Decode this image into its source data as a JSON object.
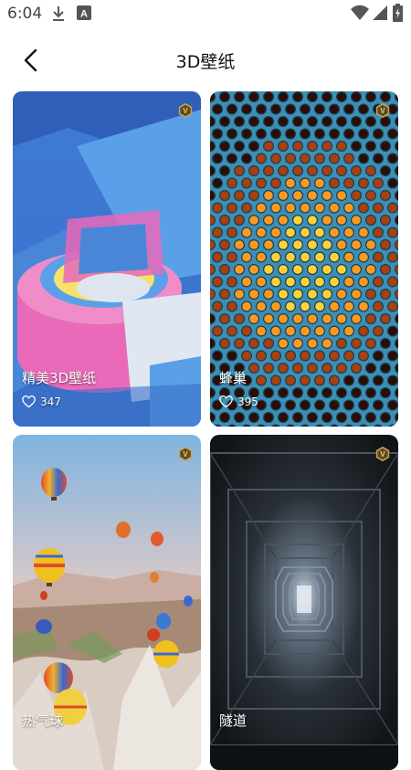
{
  "status_bar": {
    "time": "6:04",
    "icons": [
      "download-icon",
      "font-icon",
      "wifi-icon",
      "signal-icon",
      "battery-icon"
    ]
  },
  "header": {
    "title": "3D壁纸",
    "back_icon": "chevron-left-icon"
  },
  "wallpapers": [
    {
      "title": "精美3D壁纸",
      "likes": "347",
      "badge": "V"
    },
    {
      "title": "蜂巢",
      "likes": "395",
      "badge": "V"
    },
    {
      "title": "热气球",
      "likes": "",
      "badge": "V"
    },
    {
      "title": "隧道",
      "likes": "",
      "badge": "V"
    }
  ],
  "colors": {
    "background": "#ffffff",
    "badge_gold": "#c9a24a",
    "badge_dark": "#5a4a2a"
  }
}
